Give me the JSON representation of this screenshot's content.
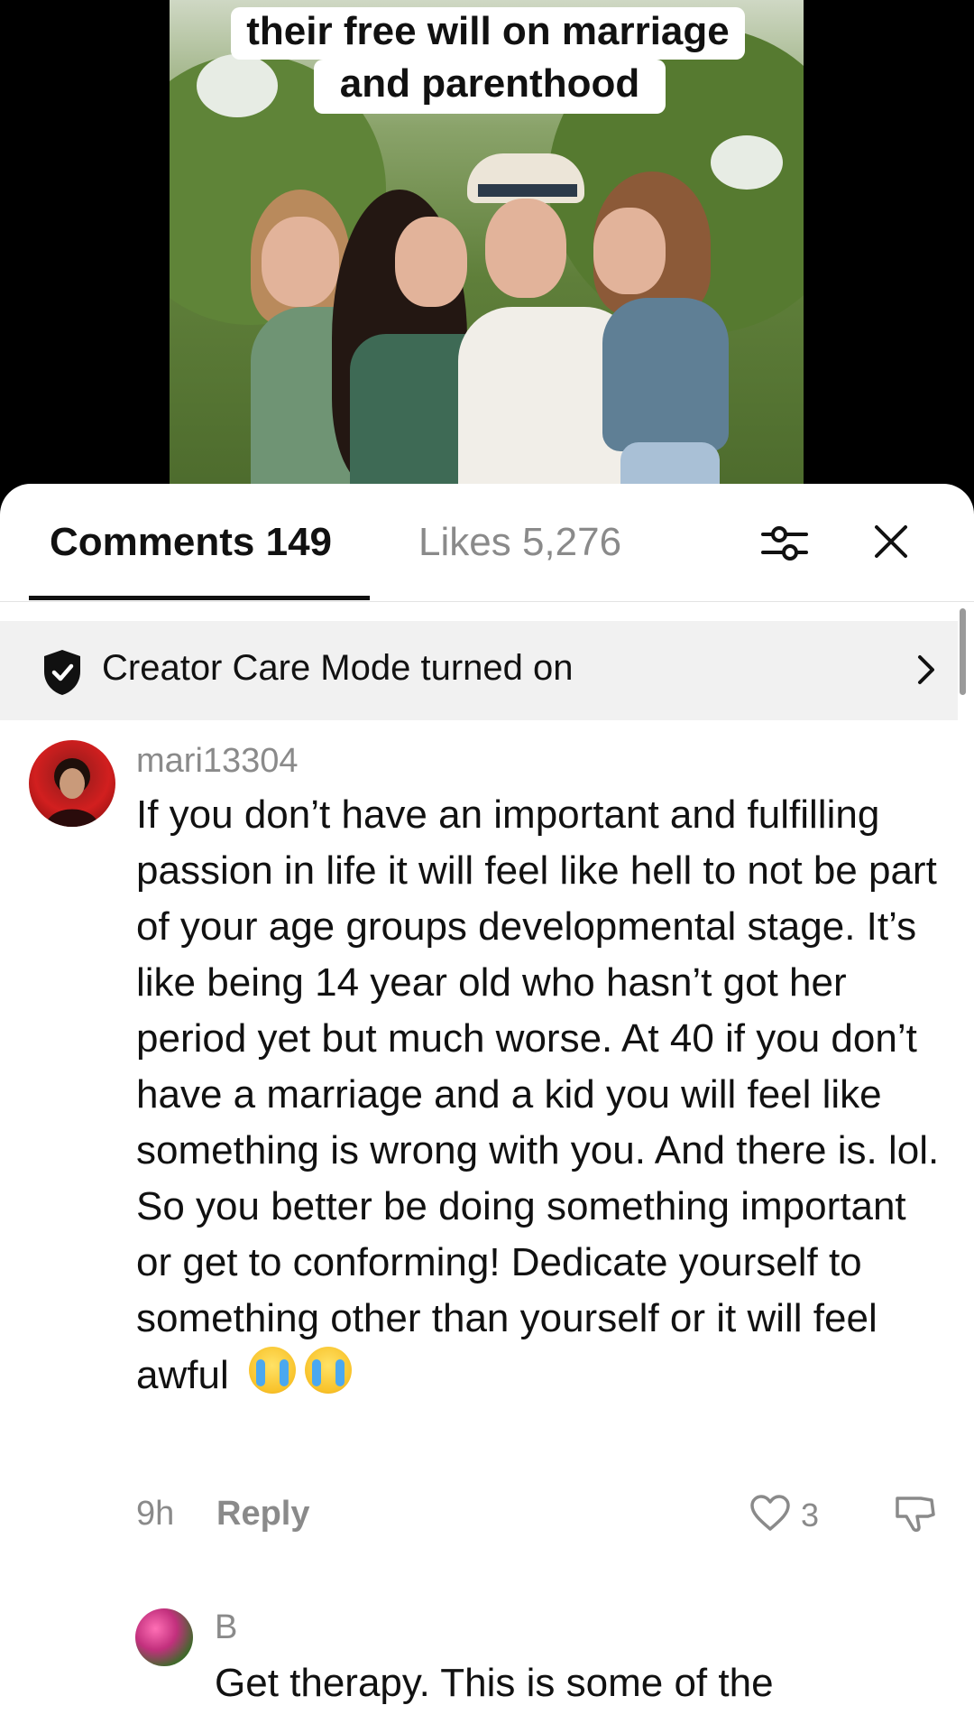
{
  "video": {
    "caption_line1": "their free will on marriage",
    "caption_line2": "and parenthood"
  },
  "tabs": {
    "comments_label": "Comments 149",
    "likes_label": "Likes 5,276"
  },
  "icons": {
    "filter": "filter-sliders-icon",
    "close": "close-icon",
    "shield": "shield-check-icon",
    "chevron": "chevron-right-icon",
    "heart": "heart-icon",
    "dislike": "thumbs-down-icon"
  },
  "banner": {
    "text": "Creator Care Mode turned on"
  },
  "comments": [
    {
      "username": "mari13304",
      "text": "If you don’t have an important and fulfilling passion in life it will feel like hell to not be part of your age groups developmental stage. It’s like being 14 year old who hasn’t got her period yet but much worse. At 40 if you don’t have a marriage and a kid you will feel like something is wrong with you. And there is. lol. So you better be doing something important or get to conforming! Dedicate yourself to something other than yourself or it will feel awful",
      "emojis": "😭 😭",
      "time": "9h",
      "reply_label": "Reply",
      "likes": "3"
    },
    {
      "username": "B",
      "text": "Get therapy. This is some of the"
    }
  ]
}
